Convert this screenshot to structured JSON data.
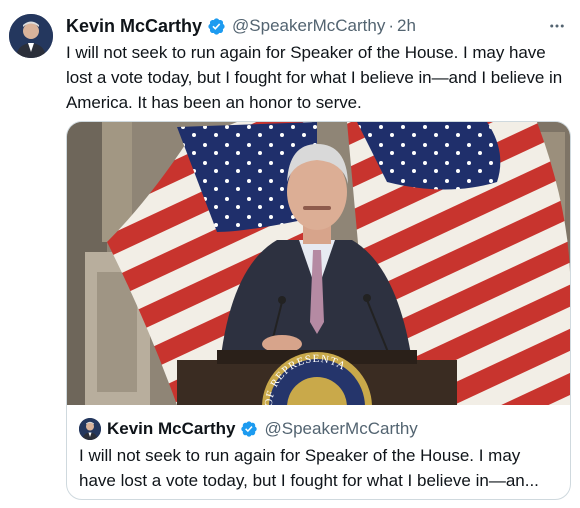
{
  "tweet": {
    "author_name": "Kevin McCarthy",
    "handle": "@SpeakerMcCarthy",
    "separator": "·",
    "time": "2h",
    "text": "I will not seek to run again for Speaker of the House. I may have lost a vote today, but I fought for what I believe in—and I believe in America. It has been an honor to serve."
  },
  "quote": {
    "author_name": "Kevin McCarthy",
    "handle": "@SpeakerMcCarthy",
    "text": "I will not seek to run again for Speaker of the House. I may have lost a vote today, but I fought for what I believe in—an..."
  },
  "media": {
    "seal_text": "OF REPRESENTA"
  },
  "icons": {
    "verified": "verified-badge-icon",
    "more": "more-horizontal-icon"
  },
  "colors": {
    "verified_blue": "#1d9bf0",
    "secondary_text": "#536471",
    "border": "#cfd9de"
  }
}
